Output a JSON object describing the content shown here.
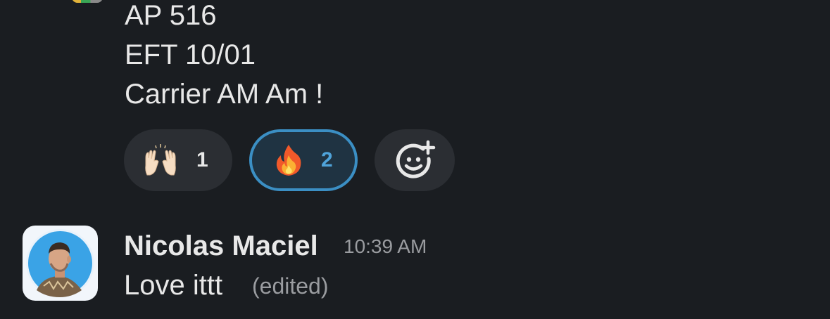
{
  "previous_message": {
    "lines": [
      "AP 516",
      "EFT 10/01",
      "Carrier AM Am !"
    ]
  },
  "reactions": [
    {
      "emoji": "raising-hands",
      "count": "1",
      "selected": false
    },
    {
      "emoji": "fire",
      "count": "2",
      "selected": true
    },
    {
      "emoji": "add-reaction-icon"
    }
  ],
  "message": {
    "author": "Nicolas Maciel",
    "timestamp": "10:39 AM",
    "text": "Love ittt",
    "edited_label": "(edited)"
  },
  "colors": {
    "background": "#1a1d21",
    "reaction_bg": "#2b2e33",
    "selected_border": "#3b8fc4",
    "selected_count": "#4fa3d9"
  }
}
